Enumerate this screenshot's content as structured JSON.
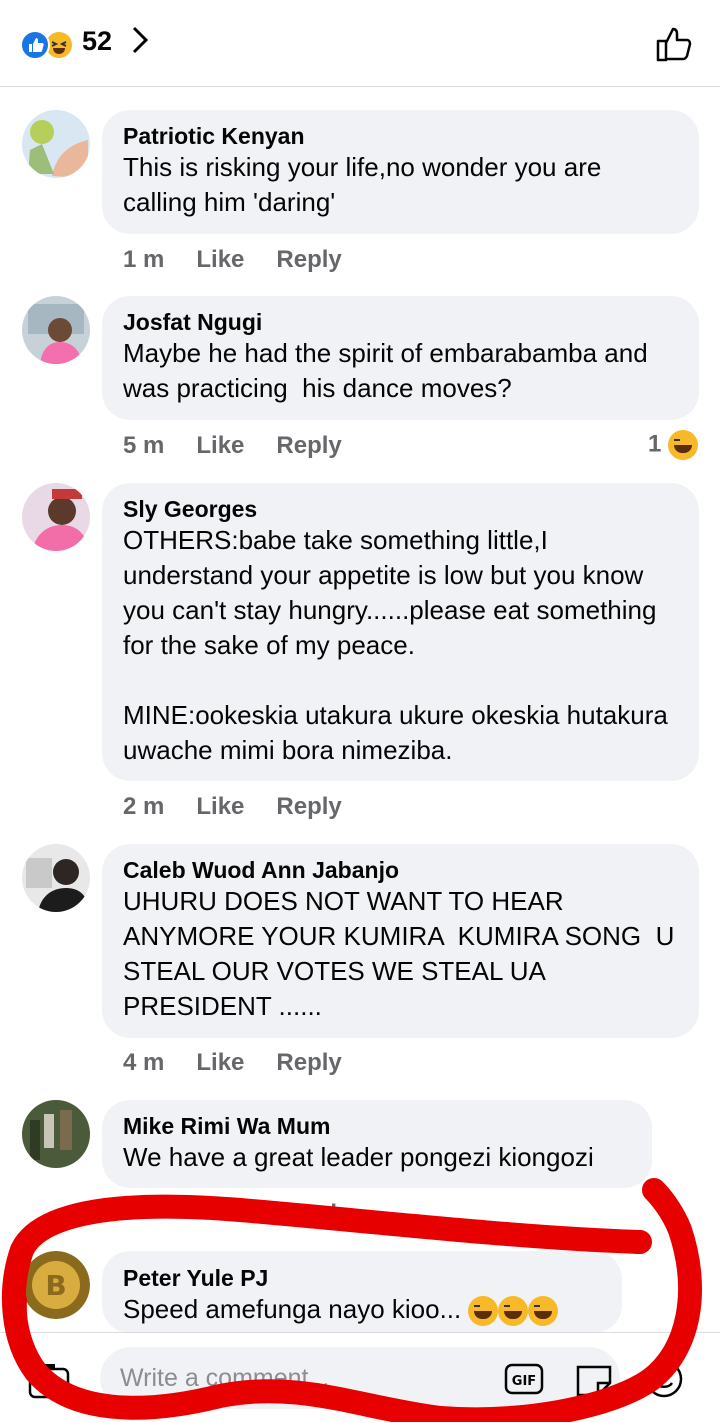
{
  "reactions": {
    "count": "52",
    "types": [
      "like-icon",
      "haha-icon"
    ]
  },
  "comments": [
    {
      "name": "Patriotic Kenyan",
      "text": "This is risking your life,no wonder you are calling him 'daring'",
      "time": "1 m",
      "like": "Like",
      "reply": "Reply"
    },
    {
      "name": "Josfat Ngugi",
      "text": "Maybe he had the spirit of embarabamba and was practicing  his dance moves?",
      "time": "5 m",
      "like": "Like",
      "reply": "Reply",
      "reaction_count": "1"
    },
    {
      "name": "Sly Georges",
      "text": "OTHERS:babe take something little,I understand your appetite is low but you know you can't stay hungry......please eat something for the sake of my peace.\n\nMINE:ookeskia utakura ukure okeskia hutakura uwache mimi bora nimeziba.",
      "time": "2 m",
      "like": "Like",
      "reply": "Reply"
    },
    {
      "name": "Caleb Wuod Ann Jabanjo",
      "text": "UHURU DOES NOT WANT TO HEAR ANYMORE YOUR KUMIRA  KUMIRA SONG  U STEAL OUR VOTES WE STEAL UA PRESIDENT ......",
      "time": "4 m",
      "like": "Like",
      "reply": "Reply"
    },
    {
      "name": "Mike Rimi Wa Mum",
      "text": "We have a great leader pongezi kiongozi",
      "time": "",
      "like": "",
      "reply": "Reply"
    },
    {
      "name": "Peter Yule PJ",
      "text": "Speed amefunga nayo kioo... ",
      "emoji_count": 3
    }
  ],
  "composer": {
    "placeholder": "Write a comment..."
  },
  "colors": {
    "bubble": "#f0f2f5",
    "meta": "#65676b",
    "annotation": "#e60000",
    "like_blue": "#1b74e4",
    "emoji_yellow": "#f7b928"
  }
}
